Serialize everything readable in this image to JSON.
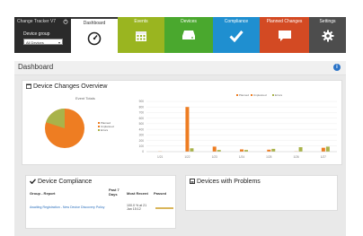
{
  "app": {
    "title": "Change Tracker V7",
    "device_group_label": "Device group",
    "device_group_value": "All Devices"
  },
  "nav": {
    "dashboard": "Dashboard",
    "events": "Events",
    "devices": "Devices",
    "compliance": "Compliance",
    "planned_changes": "Planned Changes",
    "settings": "Settings"
  },
  "page": {
    "title": "Dashboard"
  },
  "overview": {
    "title": "Device Changes Overview",
    "pie_title": "Event Totals",
    "legend": [
      "Planned",
      "Unplanned",
      "Errors"
    ]
  },
  "compliance": {
    "title": "Device Compliance",
    "headers": {
      "group": "Group - Report",
      "past7": "Past 7 Days",
      "recent": "Most Recent",
      "passed": "Passed"
    },
    "rows": [
      {
        "group": "Awaiting Registration - New Device Discovery Policy",
        "recent": "100.0 % at 21 Jan 15:12"
      }
    ]
  },
  "problems": {
    "title": "Devices with Problems"
  },
  "colors": {
    "events": "#9ab520",
    "devices": "#4aa82e",
    "compliance": "#1f8fd0",
    "planned": "#d34a23",
    "settings": "#4d4d4d",
    "bar_orange": "#ee7d22",
    "bar_olive": "#a9b34a"
  },
  "chart_data": {
    "type": "bar",
    "title": "",
    "categories": [
      "1/21",
      "1/22",
      "1/23",
      "1/24",
      "1/25",
      "1/26",
      "1/27"
    ],
    "ylim": [
      0,
      900
    ],
    "ytick_labels": [
      "900",
      "800",
      "700",
      "600",
      "500",
      "400",
      "300",
      "200",
      "100",
      "0"
    ],
    "legend_position": "top-center",
    "series": [
      {
        "name": "Planned",
        "color": "#ee7d22",
        "values": [
          0,
          0,
          0,
          0,
          0,
          0,
          0
        ]
      },
      {
        "name": "Unplanned",
        "color": "#ee7d22",
        "values": [
          5,
          800,
          90,
          40,
          35,
          5,
          70
        ]
      },
      {
        "name": "Errors",
        "color": "#a9b34a",
        "values": [
          0,
          60,
          30,
          30,
          50,
          80,
          90
        ]
      }
    ]
  }
}
